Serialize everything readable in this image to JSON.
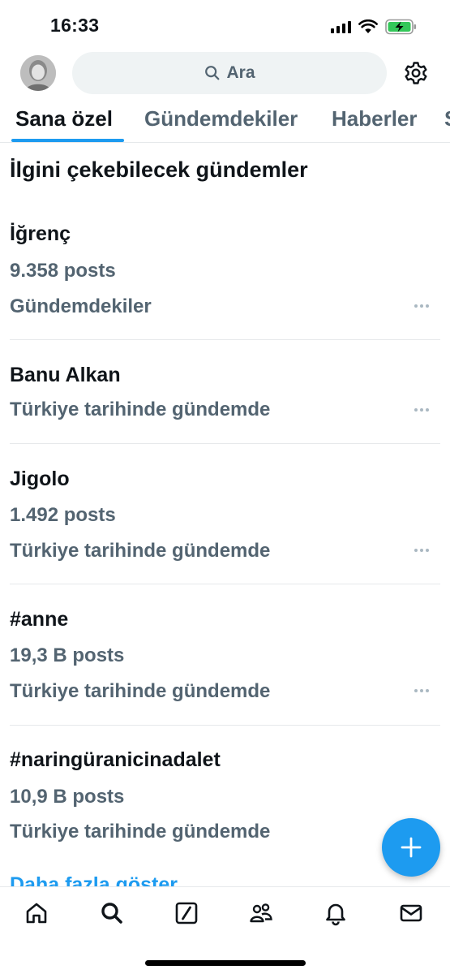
{
  "status_bar": {
    "time": "16:33"
  },
  "header": {
    "search_placeholder": "Ara"
  },
  "tabs": [
    {
      "label": "Sana özel",
      "active": true
    },
    {
      "label": "Gündemdekiler",
      "active": false
    },
    {
      "label": "Haberler",
      "active": false
    },
    {
      "label": "S",
      "active": false
    }
  ],
  "section_title": "İlgini çekebilecek gündemler",
  "trends": [
    {
      "title": "İğrenç",
      "posts": "9.358 posts",
      "meta": "Gündemdekiler"
    },
    {
      "title": "Banu Alkan",
      "posts": "",
      "meta": "Türkiye tarihinde gündemde"
    },
    {
      "title": "Jigolo",
      "posts": "1.492 posts",
      "meta": "Türkiye tarihinde gündemde"
    },
    {
      "title": "#anne",
      "posts": "19,3 B posts",
      "meta": "Türkiye tarihinde gündemde"
    },
    {
      "title": "#naringüranicinadalet",
      "posts": "10,9 B posts",
      "meta": "Türkiye tarihinde gündemde"
    }
  ],
  "show_more_label": "Daha fazla göster",
  "colors": {
    "accent": "#1d9bf0",
    "secondary_text": "#536471",
    "battery_green": "#34c759"
  }
}
